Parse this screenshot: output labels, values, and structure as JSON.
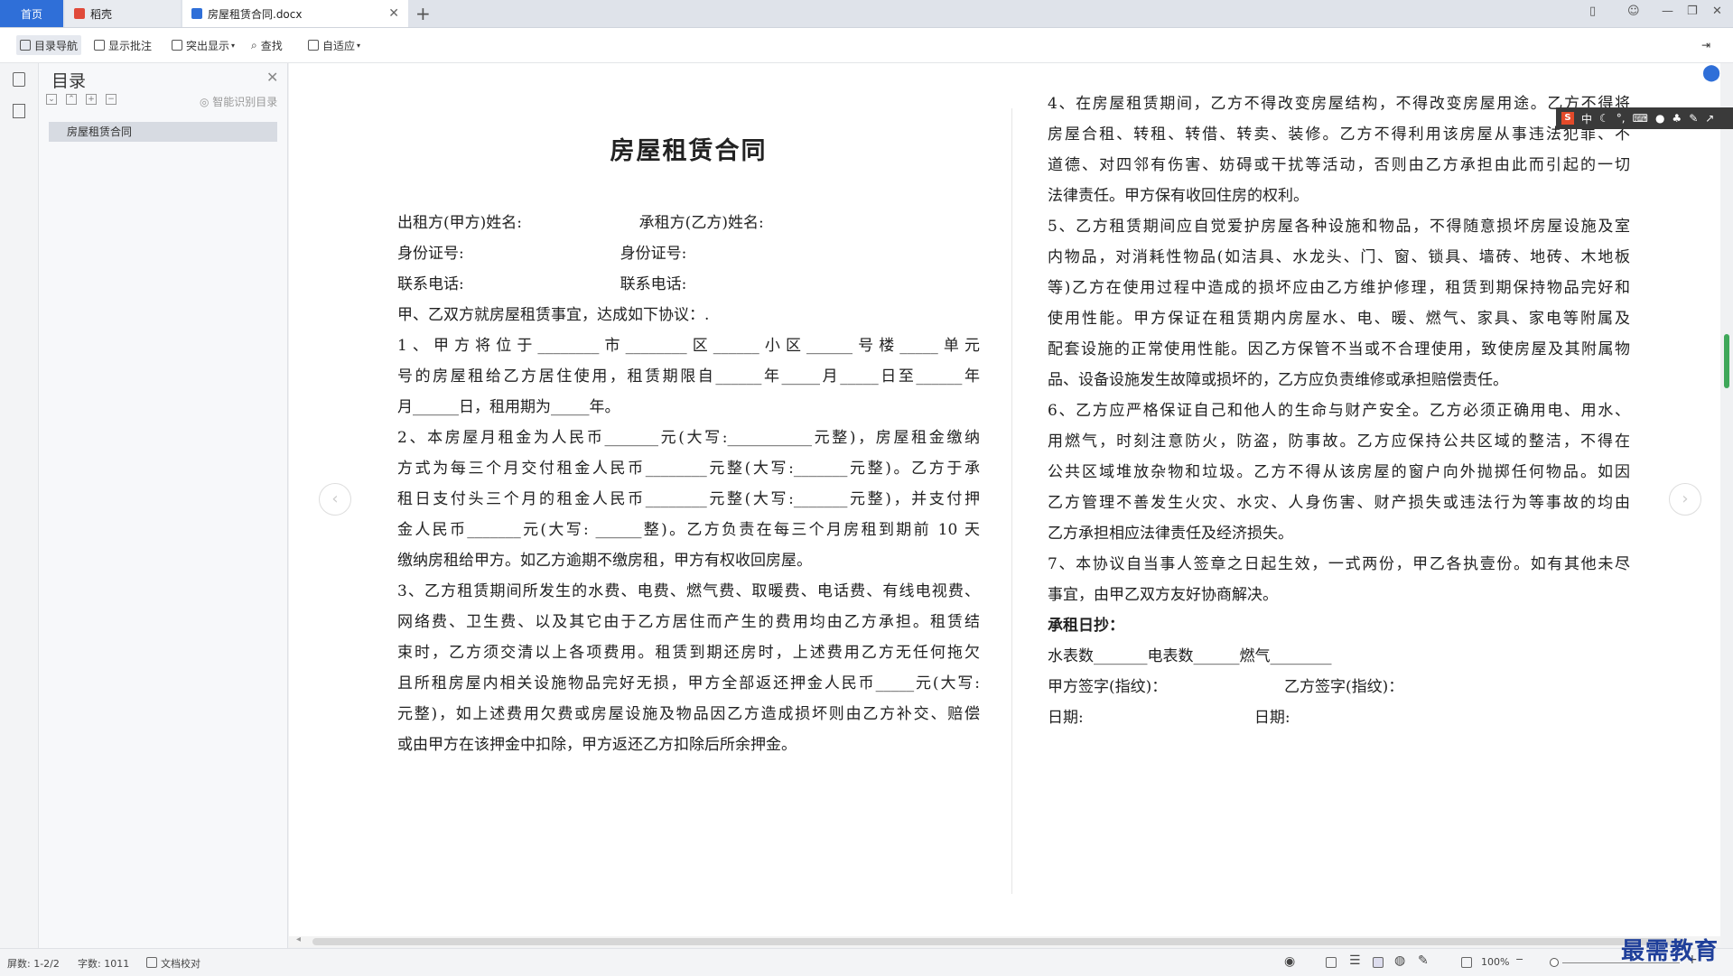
{
  "tabs": {
    "home": "首页",
    "shell": "稻壳",
    "doc": "房屋租赁合同.docx"
  },
  "toolbar": {
    "toc_nav": "目录导航",
    "show_comments": "显示批注",
    "highlight": "突出显示",
    "find": "查找",
    "fit": "自适应"
  },
  "toc": {
    "title": "目录",
    "smart": "智能识别目录",
    "items": [
      "房屋租赁合同"
    ]
  },
  "doc": {
    "title": "房屋租赁合同",
    "left": [
      "出租方(甲方)姓名:                        承租方(乙方)姓名:",
      "身份证号:                                身份证号:",
      "联系电话:                                联系电话:",
      "甲、乙双方就房屋租赁事宜，达成如下协议：.",
      "1、甲方将位于________市________区______小区______号楼_____单元",
      "号的房屋租给乙方居住使用，租赁期限自______年_____月_____日至______年",
      "月______日，租用期为_____年。",
      "2、本房屋月租金为人民币_______元(大写:___________元整)，房屋租金缴纳",
      "方式为每三个月交付租金人民币________元整(大写:_______元整)。乙方于承",
      "租日支付头三个月的租金人民币________元整(大写:_______元整)，并支付押",
      "金人民币_______元(大写: ______整)。乙方负责在每三个月房租到期前 10 天",
      "缴纳房租给甲方。如乙方逾期不缴房租，甲方有权收回房屋。",
      "3、乙方租赁期间所发生的水费、电费、燃气费、取暖费、电话费、有线电视费、",
      "网络费、卫生费、以及其它由于乙方居住而产生的费用均由乙方承担。租赁结",
      "束时，乙方须交清以上各项费用。租赁到期还房时，上述费用乙方无任何拖欠",
      "且所租房屋内相关设施物品完好无损，甲方全部返还押金人民币_____元(大写:",
      "元整)，如上述费用欠费或房屋设施及物品因乙方造成损坏则由乙方补交、赔偿",
      "或由甲方在该押金中扣除，甲方返还乙方扣除后所余押金。"
    ],
    "right": [
      "4、在房屋租赁期间，乙方不得改变房屋结构，不得改变房屋用途。乙方不得将",
      "房屋合租、转租、转借、转卖、装修。乙方不得利用该房屋从事违法犯罪、不",
      "道德、对四邻有伤害、妨碍或干扰等活动，否则由乙方承担由此而引起的一切",
      "法律责任。甲方保有收回住房的权利。",
      "5、乙方租赁期间应自觉爱护房屋各种设施和物品，不得随意损坏房屋设施及室",
      "内物品，对消耗性物品(如洁具、水龙头、门、窗、锁具、墙砖、地砖、木地板",
      "等)乙方在使用过程中造成的损坏应由乙方维护修理，租赁到期保持物品完好和",
      "使用性能。甲方保证在租赁期内房屋水、电、暖、燃气、家具、家电等附属及",
      "配套设施的正常使用性能。因乙方保管不当或不合理使用，致使房屋及其附属物",
      "品、设备设施发生故障或损坏的，乙方应负责维修或承担赔偿责任。",
      "6、乙方应严格保证自己和他人的生命与财产安全。乙方必须正确用电、用水、",
      "用燃气，时刻注意防火，防盗，防事故。乙方应保持公共区域的整洁，不得在",
      "公共区域堆放杂物和垃圾。乙方不得从该房屋的窗户向外抛掷任何物品。如因",
      "乙方管理不善发生火灾、水灾、人身伤害、财产损失或违法行为等事故的均由",
      "乙方承担相应法律责任及经济损失。",
      "7、本协议自当事人签章之日起生效，一式两份，甲乙各执壹份。如有其他未尽",
      "事宜，由甲乙双方友好协商解决。",
      "承租日抄：",
      "水表数_______电表数______燃气________",
      "甲方签字(指纹)：                        乙方签字(指纹)：",
      "日期:                                   日期:"
    ]
  },
  "ime": {
    "lang": "中"
  },
  "status": {
    "pages": "屏数: 1-2/2",
    "words": "字数: 1011",
    "proof": "文档校对",
    "zoom": "100%"
  },
  "watermark": "最需教育",
  "colors": {
    "accent": "#2f6fd8",
    "watermark": "#1f3f9a"
  }
}
